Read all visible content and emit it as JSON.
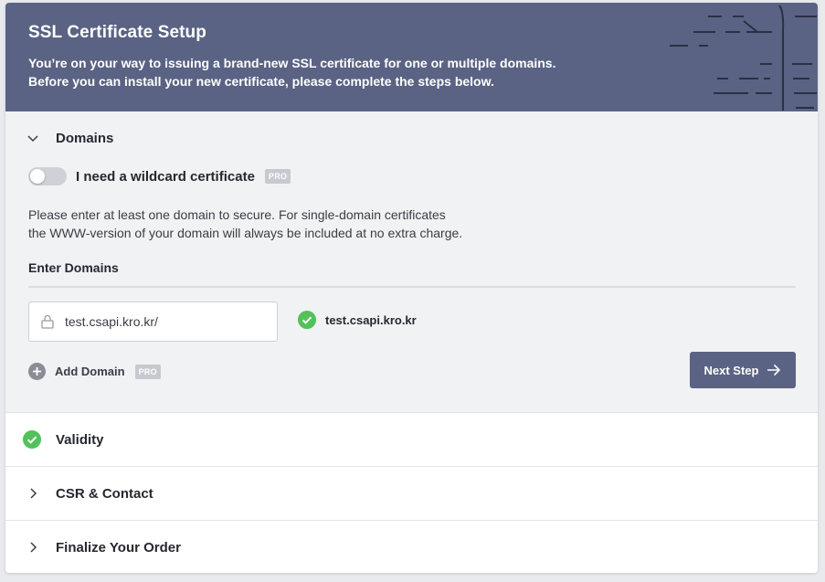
{
  "header": {
    "title": "SSL Certificate Setup",
    "description_line1": "You’re on your way to issuing a brand-new SSL certificate for one or multiple domains.",
    "description_line2": "Before you can install your new certificate, please complete the steps below."
  },
  "domains": {
    "title": "Domains",
    "wildcard_label": "I need a wildcard certificate",
    "wildcard_enabled": false,
    "pro_badge": "PRO",
    "info_line1": "Please enter at least one domain to secure. For single-domain certificates",
    "info_line2": "the WWW-version of your domain will always be included at no extra charge.",
    "enter_label": "Enter Domains",
    "input_value": "test.csapi.kro.kr/",
    "validated_domain": "test.csapi.kro.kr",
    "add_domain_label": "Add Domain",
    "next_button": "Next Step"
  },
  "steps": [
    {
      "title": "Validity",
      "status": "completed"
    },
    {
      "title": "CSR & Contact",
      "status": "collapsed"
    },
    {
      "title": "Finalize Your Order",
      "status": "collapsed"
    }
  ],
  "colors": {
    "header_bg": "#5a6383",
    "section_bg": "#f1f2f4",
    "success": "#52c15a",
    "button_bg": "#5a6383"
  },
  "icons": [
    "chevron-down-icon",
    "lock-icon",
    "check-circle-icon",
    "plus-circle-icon",
    "arrow-right-icon",
    "chevron-right-icon"
  ]
}
